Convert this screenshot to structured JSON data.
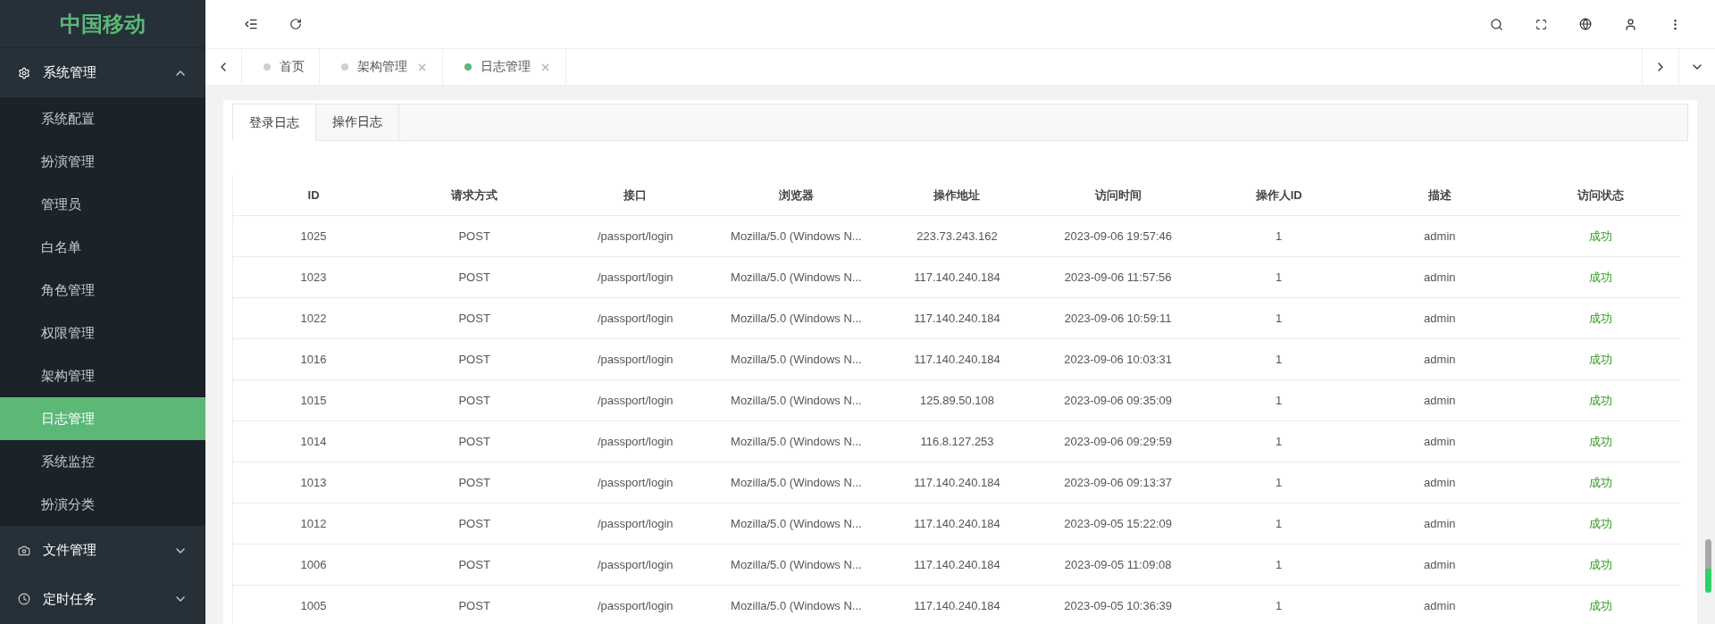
{
  "logo": "中国移动",
  "sidebar": {
    "groups": [
      {
        "label": "系统管理",
        "expanded": true,
        "children": [
          {
            "label": "系统配置",
            "selected": false
          },
          {
            "label": "扮演管理",
            "selected": false
          },
          {
            "label": "管理员",
            "selected": false
          },
          {
            "label": "白名单",
            "selected": false
          },
          {
            "label": "角色管理",
            "selected": false
          },
          {
            "label": "权限管理",
            "selected": false
          },
          {
            "label": "架构管理",
            "selected": false
          },
          {
            "label": "日志管理",
            "selected": true
          },
          {
            "label": "系统监控",
            "selected": false
          },
          {
            "label": "扮演分类",
            "selected": false
          }
        ]
      },
      {
        "label": "文件管理",
        "expanded": false
      },
      {
        "label": "定时任务",
        "expanded": false
      }
    ]
  },
  "page_tabs": [
    {
      "label": "首页",
      "selected": false,
      "closable": false
    },
    {
      "label": "架构管理",
      "selected": false,
      "closable": true
    },
    {
      "label": "日志管理",
      "selected": true,
      "closable": true
    }
  ],
  "content_tabs": [
    {
      "label": "登录日志",
      "selected": true
    },
    {
      "label": "操作日志",
      "selected": false
    }
  ],
  "table": {
    "columns": [
      "ID",
      "请求方式",
      "接口",
      "浏览器",
      "操作地址",
      "访问时间",
      "操作人ID",
      "描述",
      "访问状态"
    ],
    "rows": [
      [
        "1025",
        "POST",
        "/passport/login",
        "Mozilla/5.0 (Windows N...",
        "223.73.243.162",
        "2023-09-06 19:57:46",
        "1",
        "admin",
        "成功"
      ],
      [
        "1023",
        "POST",
        "/passport/login",
        "Mozilla/5.0 (Windows N...",
        "117.140.240.184",
        "2023-09-06 11:57:56",
        "1",
        "admin",
        "成功"
      ],
      [
        "1022",
        "POST",
        "/passport/login",
        "Mozilla/5.0 (Windows N...",
        "117.140.240.184",
        "2023-09-06 10:59:11",
        "1",
        "admin",
        "成功"
      ],
      [
        "1016",
        "POST",
        "/passport/login",
        "Mozilla/5.0 (Windows N...",
        "117.140.240.184",
        "2023-09-06 10:03:31",
        "1",
        "admin",
        "成功"
      ],
      [
        "1015",
        "POST",
        "/passport/login",
        "Mozilla/5.0 (Windows N...",
        "125.89.50.108",
        "2023-09-06 09:35:09",
        "1",
        "admin",
        "成功"
      ],
      [
        "1014",
        "POST",
        "/passport/login",
        "Mozilla/5.0 (Windows N...",
        "116.8.127.253",
        "2023-09-06 09:29:59",
        "1",
        "admin",
        "成功"
      ],
      [
        "1013",
        "POST",
        "/passport/login",
        "Mozilla/5.0 (Windows N...",
        "117.140.240.184",
        "2023-09-06 09:13:37",
        "1",
        "admin",
        "成功"
      ],
      [
        "1012",
        "POST",
        "/passport/login",
        "Mozilla/5.0 (Windows N...",
        "117.140.240.184",
        "2023-09-05 15:22:09",
        "1",
        "admin",
        "成功"
      ],
      [
        "1006",
        "POST",
        "/passport/login",
        "Mozilla/5.0 (Windows N...",
        "117.140.240.184",
        "2023-09-05 11:09:08",
        "1",
        "admin",
        "成功"
      ],
      [
        "1005",
        "POST",
        "/passport/login",
        "Mozilla/5.0 (Windows N...",
        "117.140.240.184",
        "2023-09-05 10:36:39",
        "1",
        "admin",
        "成功"
      ]
    ]
  }
}
